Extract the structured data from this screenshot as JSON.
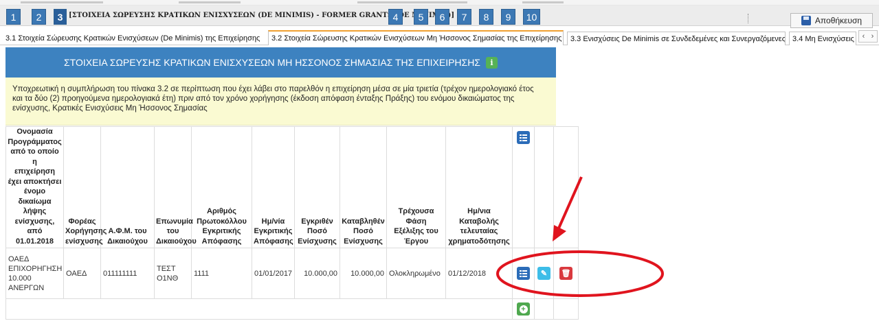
{
  "steps": [
    {
      "label": "1"
    },
    {
      "label": "2"
    },
    {
      "label": "3"
    },
    {
      "label": "4"
    },
    {
      "label": "5"
    },
    {
      "label": "6"
    },
    {
      "label": "7"
    },
    {
      "label": "8"
    },
    {
      "label": "9"
    },
    {
      "label": "10"
    }
  ],
  "step_title": "[ΣΤΟΙΧΕΙΑ ΣΩΡΕΥΣΗΣ ΚΡΑΤΙΚΩΝ ΕΝΙΣΧΥΣΕΩΝ (DE MINIMIS) - FORMER GRANTS (DE MINIMIS)]",
  "save_label": "Αποθήκευση",
  "tabs": [
    {
      "label": "3.1 Στοιχεία Σώρευσης Κρατικών Ενισχύσεων (De Minimis) της Επιχείρησης"
    },
    {
      "label": "3.2 Στοιχεία Σώρευσης Κρατικών Ενισχύσεων Μη Ήσσονος Σημασίας της Επιχείρησης"
    },
    {
      "label": "3.3 Ενισχύσεις De Minimis σε Συνδεδεμένες και Συνεργαζόμενες"
    },
    {
      "label": "3.4 Μη Ενισχύσεις"
    }
  ],
  "panel": {
    "title": "ΣΤΟΙΧΕΙΑ ΣΩΡΕΥΣΗΣ ΚΡΑΤΙΚΩΝ ΕΝΙΣΧΥΣΕΩΝ ΜΗ ΗΣΣΟΝΟΣ ΣΗΜΑΣΙΑΣ ΤΗΣ ΕΠΙΧΕΙΡΗΣΗΣ",
    "info_glyph": "i",
    "notice_lines": [
      "Υποχρεωτική η συμπλήρωση του πίνακα 3.2 σε περίπτωση που έχει λάβει στο παρελθόν η επιχείρηση μέσα σε μία τριετία (τρέχον ημερολογιακό έτος",
      "και τα δύο (2) προηγούμενα ημερολογιακά έτη) πριν από τον χρόνο χορήγησης (έκδοση απόφαση ένταξης Πράξης) του ενόμου δικαιώματος της",
      "ενίσχυσης, Κρατικές Ενισχύσεις Μη Ήσσονος Σημασίας"
    ]
  },
  "table": {
    "headers": [
      [
        "Ονομασία",
        "Προγράμματος",
        "από το οποίο η",
        "επιχείρηση",
        "έχει αποκτήσει",
        "ένομο",
        "δικαίωμα",
        "λήψης",
        "ενίσχυσης, από",
        "01.01.2018"
      ],
      [
        "Φορέας",
        "Χορήγησης",
        "ενίσχυσης"
      ],
      [
        "Α.Φ.Μ. του",
        "Δικαιούχου"
      ],
      [
        "Επωνυμία",
        "του",
        "Δικαιούχου"
      ],
      [
        "Αριθμός",
        "Πρωτοκόλλου",
        "Εγκριτικής",
        "Απόφασης"
      ],
      [
        "Ημ/νία",
        "Εγκριτικής",
        "Απόφασης"
      ],
      [
        "Εγκριθέν",
        "Ποσό",
        "Ενίσχυσης"
      ],
      [
        "Καταβληθέν",
        "Ποσό",
        "Ενίσχυσης"
      ],
      [
        "Τρέχουσα",
        "Φάση",
        "Εξέλιξης του",
        "Έργου"
      ],
      [
        "Ημ/νια",
        "Καταβολής",
        "τελευταίας",
        "χρηματοδότησης"
      ]
    ],
    "rows": [
      {
        "program": [
          "ΟΑΕΔ",
          "ΕΠΙΧΟΡΗΓΗΣΗ",
          "10.000",
          "ΑΝΕΡΓΩΝ"
        ],
        "agency": "ΟΑΕΔ",
        "afm": "011111111",
        "name": [
          "ΤΕΣΤ",
          "Ο1ΝΘ"
        ],
        "protocol": "1111",
        "approval_date": "01/01/2017",
        "approved_amount": "10.000,00",
        "paid_amount": "10.000,00",
        "phase": "Ολοκληρωμένο",
        "last_payment_date": "01/12/2018"
      }
    ]
  },
  "colors": {
    "step_blue": "#3c78b4",
    "panel_header": "#3d82c0",
    "notice_bg": "#fafad2",
    "list_icon": "#2b6cb8",
    "edit_icon": "#3dbde8",
    "delete_icon": "#d9393e",
    "add_icon": "#4fa84f",
    "annotation_red": "#e0141e",
    "active_tab_accent": "#f0a030"
  },
  "icons": {
    "header_list": "list-icon",
    "row_list": "list-icon",
    "row_edit": "edit-icon",
    "row_delete": "trash-icon",
    "add": "plus-circle-icon",
    "save": "floppy-disk-icon",
    "info": "info-icon"
  },
  "tab_nav": {
    "prev": "‹",
    "next": "›"
  }
}
